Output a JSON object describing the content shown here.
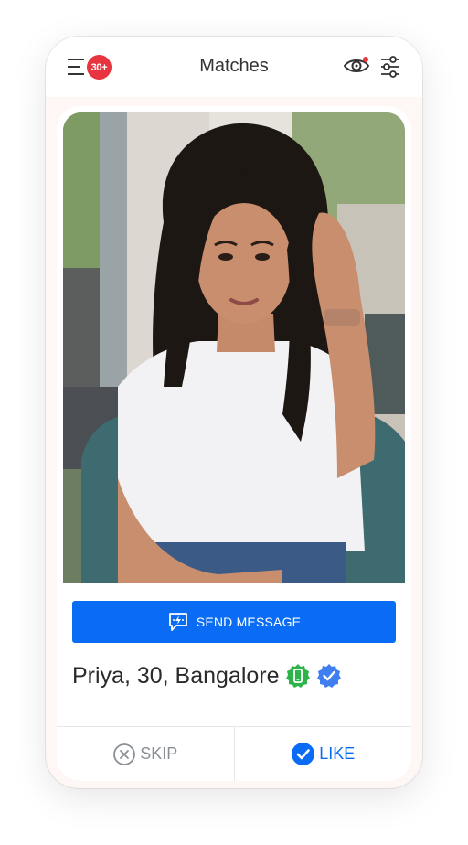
{
  "header": {
    "title": "Matches",
    "badge_count": "30+"
  },
  "profile": {
    "name_line": "Priya, 30, Bangalore",
    "photo_alt": "Profile photo of Priya"
  },
  "buttons": {
    "send_message": "SEND MESSAGE",
    "skip": "SKIP",
    "like": "LIKE"
  },
  "icons": {
    "menu": "menu-icon",
    "eye": "eye-icon",
    "filter": "filter-sliders-icon",
    "chat": "chat-bolt-icon",
    "phone_verified": "phone-verified-icon",
    "verified": "verified-badge-icon",
    "skip": "close-circle-icon",
    "like": "check-circle-icon"
  },
  "colors": {
    "accent_blue": "#0a6cf5",
    "badge_red": "#e8343f",
    "verified_green": "#2db34a",
    "verified_blue": "#3f7ff0"
  }
}
